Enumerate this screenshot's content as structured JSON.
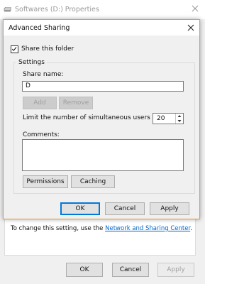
{
  "parent_window": {
    "title": "Softwares (D:) Properties",
    "hint_text": "To change this setting, use the ",
    "hint_link": "Network and Sharing Center",
    "hint_suffix": ".",
    "buttons": {
      "ok": "OK",
      "cancel": "Cancel",
      "apply": "Apply"
    }
  },
  "dialog": {
    "title": "Advanced Sharing",
    "share_checkbox": {
      "label": "Share this folder",
      "checked": true
    },
    "settings_group": "Settings",
    "share_name": {
      "label": "Share name:",
      "value": "D"
    },
    "add_button": "Add",
    "remove_button": "Remove",
    "limit_users": {
      "label": "Limit the number of simultaneous users to:",
      "value": "20"
    },
    "comments": {
      "label": "Comments:",
      "value": ""
    },
    "permissions_button": "Permissions",
    "caching_button": "Caching",
    "buttons": {
      "ok": "OK",
      "cancel": "Cancel",
      "apply": "Apply"
    }
  },
  "icons": [
    "drive-icon",
    "close-icon",
    "checkmark-icon",
    "spin-up-icon",
    "spin-down-icon"
  ],
  "colors": {
    "accent": "#0078d7",
    "link": "#0066cc",
    "dialog_border": "#d8a04a"
  }
}
